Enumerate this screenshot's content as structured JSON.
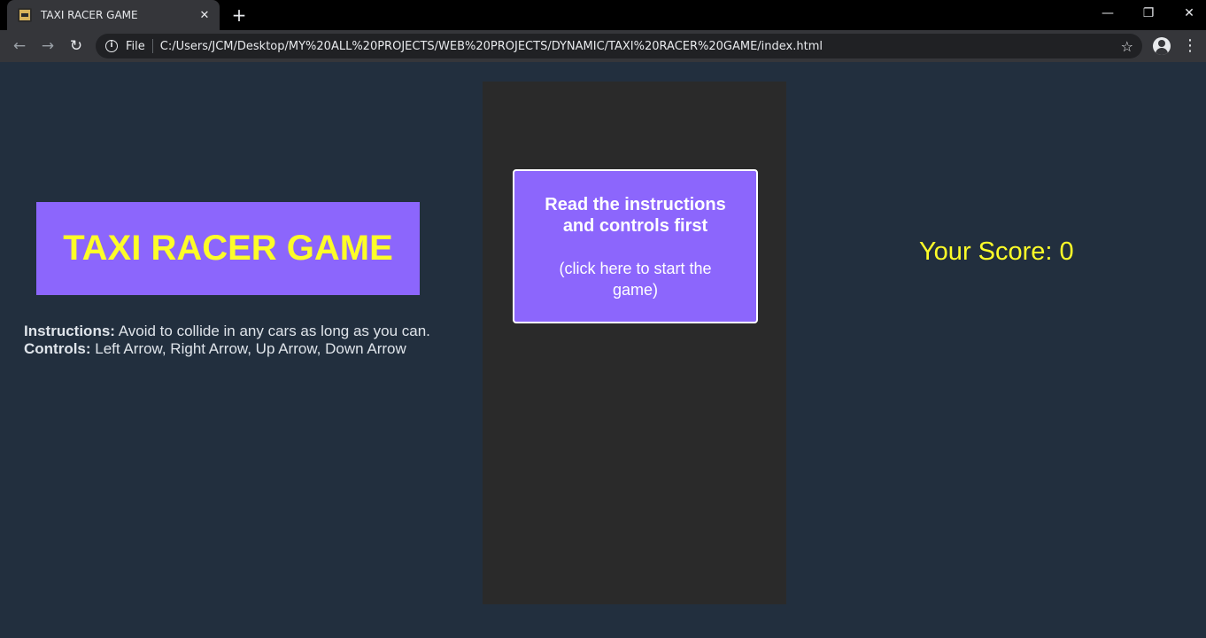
{
  "browser": {
    "tab_title": "TAXI RACER GAME",
    "tab_close": "✕",
    "new_tab": "+",
    "scheme_label": "File",
    "url": "C:/Users/JCM/Desktop/MY%20ALL%20PROJECTS/WEB%20PROJECTS/DYNAMIC/TAXI%20RACER%20GAME/index.html",
    "back": "←",
    "forward": "→",
    "reload": "↻",
    "star": "☆",
    "menu": "⋮",
    "minimize": "—",
    "restore": "❐",
    "close": "✕"
  },
  "page": {
    "title": "TAXI RACER GAME",
    "instructions_label": "Instructions:",
    "instructions_text": " Avoid to collide in any cars as long as you can.",
    "controls_label": "Controls:",
    "controls_text": " Left Arrow, Right Arrow, Up Arrow, Down Arrow",
    "start_main": "Read the instructions and controls first",
    "start_sub": "(click here to start the game)",
    "score_label": "Your Score: 0"
  },
  "colors": {
    "background": "#222f3e",
    "accent_purple": "#8c66fc",
    "title_yellow": "#fdfd28",
    "road": "#2a2a2a"
  }
}
